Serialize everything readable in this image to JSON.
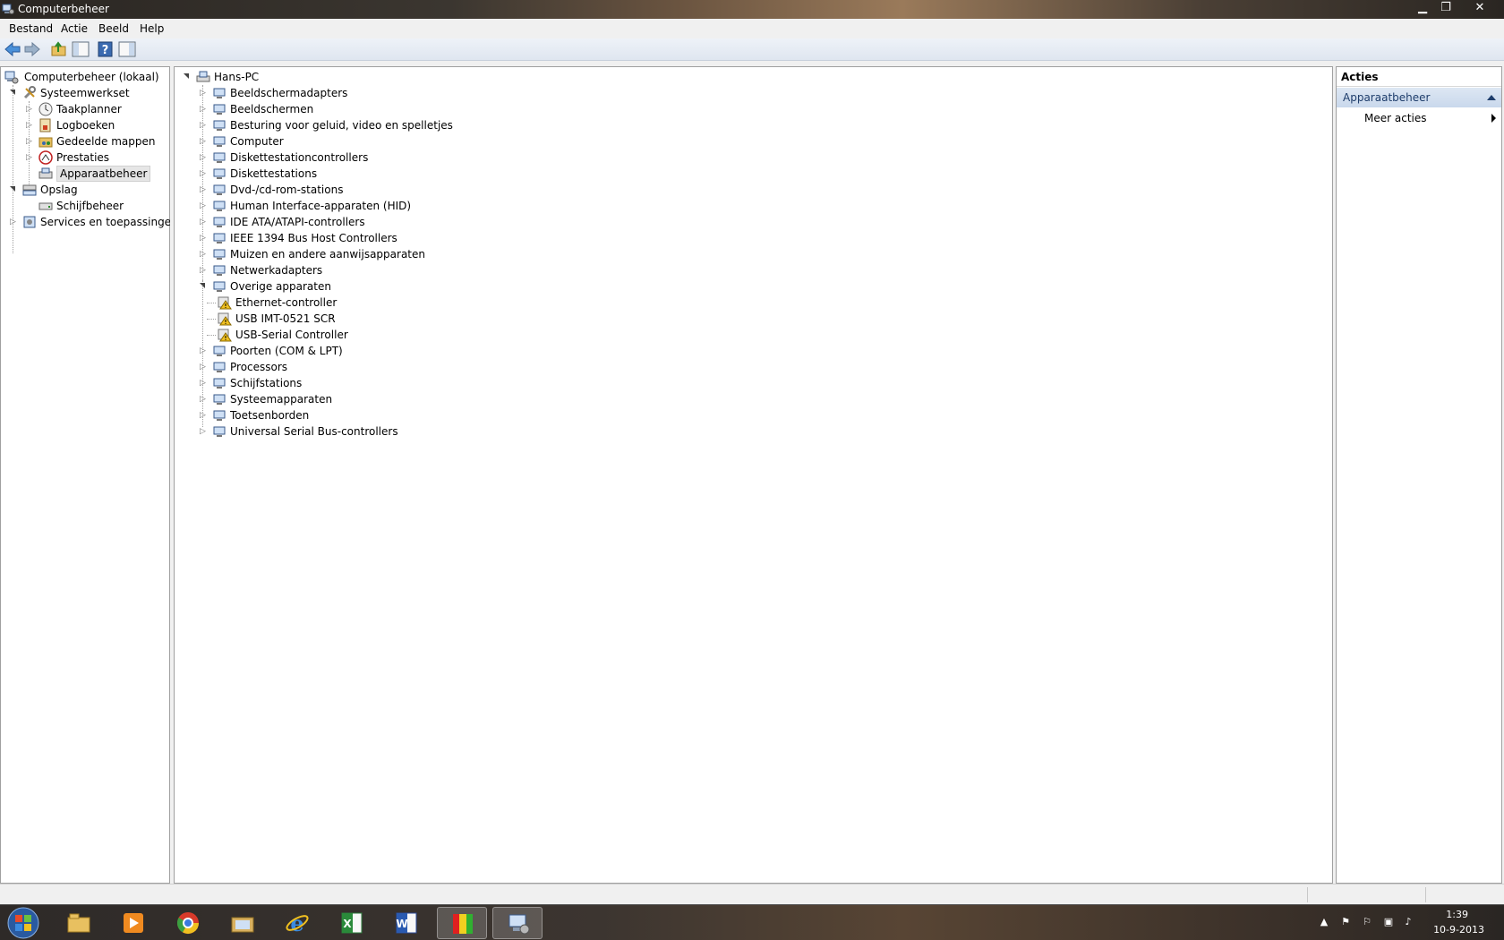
{
  "window": {
    "title": "Computerbeheer"
  },
  "menubar": {
    "items": [
      "Bestand",
      "Actie",
      "Beeld",
      "Help"
    ]
  },
  "left_tree": {
    "root": "Computerbeheer (lokaal)",
    "items": [
      {
        "label": "Systeemwerkset",
        "icon": "tools-icon",
        "expanded": true
      },
      {
        "label": "Taakplanner",
        "icon": "clock-icon"
      },
      {
        "label": "Logboeken",
        "icon": "event-log-icon"
      },
      {
        "label": "Gedeelde mappen",
        "icon": "shared-folder-icon"
      },
      {
        "label": "Prestaties",
        "icon": "performance-icon"
      },
      {
        "label": "Apparaatbeheer",
        "icon": "device-manager-icon",
        "selected": true
      },
      {
        "label": "Opslag",
        "icon": "storage-icon",
        "expanded": true
      },
      {
        "label": "Schijfbeheer",
        "icon": "disk-icon"
      },
      {
        "label": "Services en toepassingen",
        "icon": "services-icon"
      }
    ]
  },
  "device_tree": {
    "root": "Hans-PC",
    "categories": [
      "Beeldschermadapters",
      "Beeldschermen",
      "Besturing voor geluid, video en spelletjes",
      "Computer",
      "Diskettestationcontrollers",
      "Diskettestations",
      "Dvd-/cd-rom-stations",
      "Human Interface-apparaten (HID)",
      "IDE ATA/ATAPI-controllers",
      "IEEE 1394 Bus Host Controllers",
      "Muizen en andere aanwijsapparaten",
      "Netwerkadapters",
      "Overige apparaten",
      "Poorten (COM & LPT)",
      "Processors",
      "Schijfstations",
      "Systeemapparaten",
      "Toetsenborden",
      "Universal Serial Bus-controllers"
    ],
    "other_devices": [
      "Ethernet-controller",
      "USB IMT-0521 SCR",
      "USB-Serial Controller"
    ]
  },
  "actions_pane": {
    "header": "Acties",
    "section": "Apparaatbeheer",
    "item": "Meer acties"
  },
  "taskbar": {
    "time": "1:39",
    "date": "10-9-2013",
    "apps": [
      "explorer-icon",
      "media-player-icon",
      "chrome-icon",
      "folder-icon",
      "ie-icon",
      "excel-icon",
      "word-icon",
      "colorbars-icon",
      "computer-management-icon"
    ]
  }
}
